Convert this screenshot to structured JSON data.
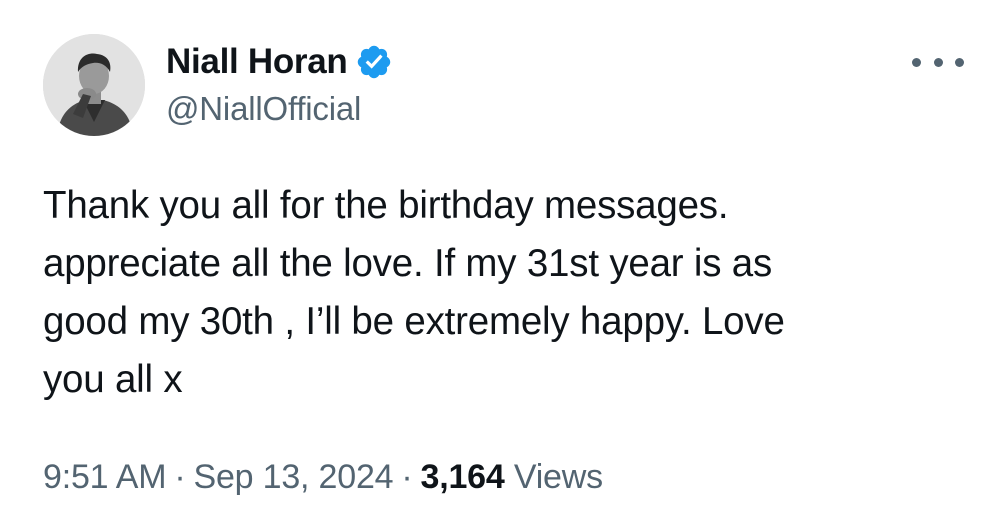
{
  "author": {
    "display_name": "Niall Horan",
    "handle": "@NiallOfficial",
    "verified": true,
    "verified_badge_icon": "verified-badge-icon",
    "verified_color": "#1d9bf0",
    "avatar_icon": "profile-photo"
  },
  "tweet": {
    "text_lines": [
      "Thank you all for the birthday messages.",
      "appreciate all the love. If my 31st year is as",
      "good my 30th , I’ll be extremely happy. Love",
      "you all x"
    ]
  },
  "meta": {
    "time": "9:51 AM",
    "separator": "·",
    "date": "Sep 13, 2024",
    "views_count": "3,164",
    "views_label": "Views"
  },
  "menu": {
    "icon": "more-options-icon"
  },
  "colors": {
    "text_primary": "#0f1419",
    "text_secondary": "#536471"
  }
}
